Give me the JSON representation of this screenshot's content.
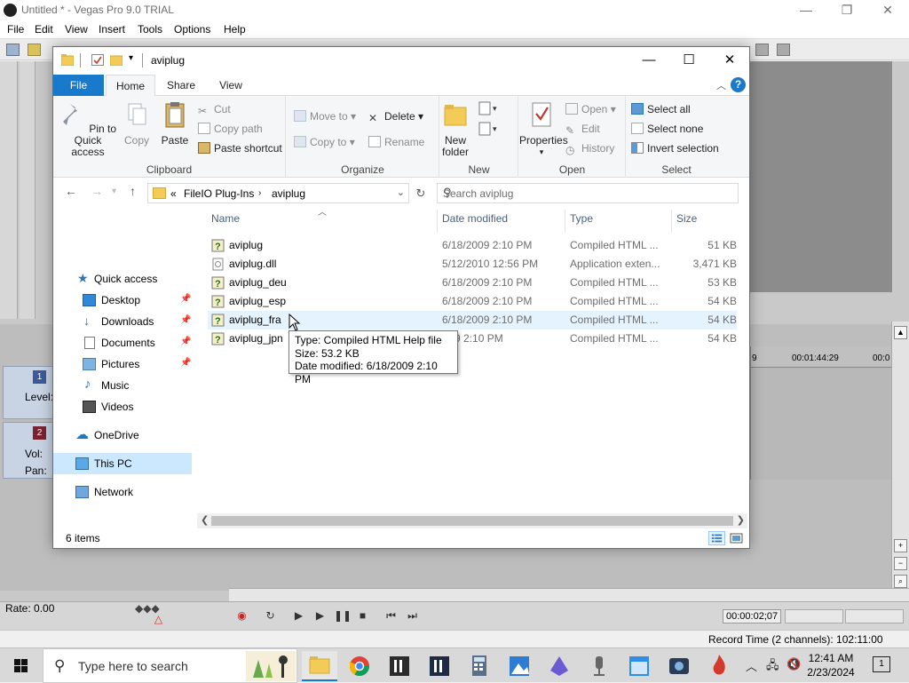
{
  "vegas": {
    "title": "Untitled * - Vegas Pro 9.0 TRIAL",
    "menu": [
      "File",
      "Edit",
      "View",
      "Insert",
      "Tools",
      "Options",
      "Help"
    ],
    "tracks": [
      {
        "number": "1",
        "labels": [
          "Level:"
        ]
      },
      {
        "number": "2",
        "labels": [
          "Vol:",
          "Pan:"
        ]
      }
    ],
    "timeline": {
      "tick_1": "9",
      "tick_2": "00:01:44:29",
      "tick_3": "00:0"
    },
    "rate": "Rate: 0.00",
    "time_readout": "00:00:02;07",
    "record_time": "Record Time (2 channels): 102:11:00"
  },
  "explorer": {
    "title": "aviplug",
    "tabs": {
      "file": "File",
      "home": "Home",
      "share": "Share",
      "view": "View"
    },
    "ribbon": {
      "clipboard": {
        "label": "Clipboard",
        "pin": "Pin to Quick access",
        "copy": "Copy",
        "paste": "Paste",
        "cut": "Cut",
        "copy_path": "Copy path",
        "paste_shortcut": "Paste shortcut"
      },
      "organize": {
        "label": "Organize",
        "move_to": "Move to",
        "copy_to": "Copy to",
        "delete": "Delete",
        "rename": "Rename"
      },
      "new": {
        "label": "New",
        "new_folder": "New folder"
      },
      "open": {
        "label": "Open",
        "properties": "Properties",
        "open": "Open",
        "edit": "Edit",
        "history": "History"
      },
      "select": {
        "label": "Select",
        "select_all": "Select all",
        "select_none": "Select none",
        "invert": "Invert selection"
      }
    },
    "address": {
      "prefix": "«",
      "crumb_1": "FileIO Plug-Ins",
      "crumb_2": "aviplug"
    },
    "search_placeholder": "Search aviplug",
    "nav": {
      "quick_access": "Quick access",
      "desktop": "Desktop",
      "downloads": "Downloads",
      "documents": "Documents",
      "pictures": "Pictures",
      "music": "Music",
      "videos": "Videos",
      "onedrive": "OneDrive",
      "this_pc": "This PC",
      "network": "Network"
    },
    "columns": {
      "name": "Name",
      "date": "Date modified",
      "type": "Type",
      "size": "Size"
    },
    "files": [
      {
        "name": "aviplug",
        "date": "6/18/2009 2:10 PM",
        "type": "Compiled HTML ...",
        "size": "51 KB"
      },
      {
        "name": "aviplug.dll",
        "date": "5/12/2010 12:56 PM",
        "type": "Application exten...",
        "size": "3,471 KB"
      },
      {
        "name": "aviplug_deu",
        "date": "6/18/2009 2:10 PM",
        "type": "Compiled HTML ...",
        "size": "53 KB"
      },
      {
        "name": "aviplug_esp",
        "date": "6/18/2009 2:10 PM",
        "type": "Compiled HTML ...",
        "size": "54 KB"
      },
      {
        "name": "aviplug_fra",
        "date": "6/18/2009 2:10 PM",
        "type": "Compiled HTML ...",
        "size": "54 KB"
      },
      {
        "name": "aviplug_jpn",
        "date": "9 2:10 PM",
        "type": "Compiled HTML ...",
        "size": "54 KB"
      }
    ],
    "tooltip": {
      "type": "Type: Compiled HTML Help file",
      "size": "Size: 53.2 KB",
      "date": "Date modified: 6/18/2009 2:10 PM"
    },
    "status": "6 items"
  },
  "taskbar": {
    "search_placeholder": "Type here to search",
    "time": "12:41 AM",
    "date": "2/23/2024",
    "notifications": "1"
  },
  "colors": {
    "accent": "#1979ca",
    "folder": "#f3cc58",
    "selection": "#cce8ff",
    "hover": "#e5f3ff"
  }
}
